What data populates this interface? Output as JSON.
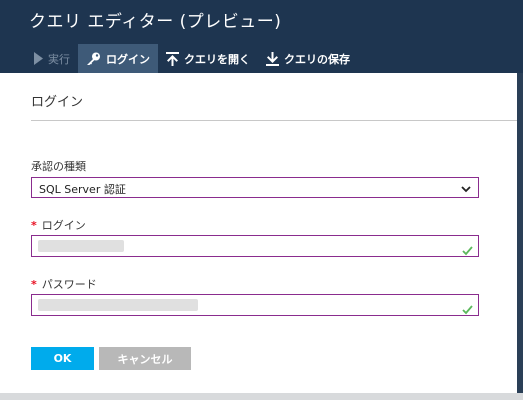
{
  "window": {
    "title": "クエリ エディター (プレビュー)"
  },
  "toolbar": {
    "items": [
      {
        "label": "実行",
        "icon": "play-icon",
        "state": "disabled"
      },
      {
        "label": "ログイン",
        "icon": "key-icon",
        "state": "active"
      },
      {
        "label": "クエリを開く",
        "icon": "upload-icon",
        "state": "normal"
      },
      {
        "label": "クエリの保存",
        "icon": "download-icon",
        "state": "normal"
      }
    ]
  },
  "panel": {
    "title": "ログイン",
    "auth": {
      "label": "承認の種類",
      "selected": "SQL Server 認証"
    },
    "login": {
      "required_mark": "*",
      "label": "ログイン"
    },
    "password": {
      "required_mark": "*",
      "label": "パスワード"
    },
    "buttons": {
      "ok": "OK",
      "cancel": "キャンセル"
    }
  },
  "colors": {
    "header_bg": "#1e3550",
    "toolbar_active": "#3e5a78",
    "field_border": "#8a2c8e",
    "check": "#5cb85c",
    "ok_button": "#00abec",
    "cancel_button": "#b8b8b8",
    "required": "#e81123"
  }
}
